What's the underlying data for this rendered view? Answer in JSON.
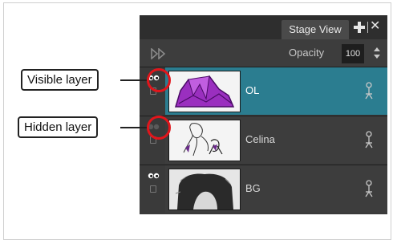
{
  "panel": {
    "tab_label": "Stage View",
    "opacity_label": "Opacity",
    "opacity_value": "100"
  },
  "layers": [
    {
      "name": "OL",
      "visible": true,
      "selected": true
    },
    {
      "name": "Celina",
      "visible": false,
      "selected": false
    },
    {
      "name": "BG",
      "visible": true,
      "selected": false
    }
  ],
  "callouts": {
    "visible": "Visible layer",
    "hidden": "Hidden layer"
  },
  "colors": {
    "selected_row": "#2b7d90",
    "highlight_ring": "#e2151b",
    "panel_bg": "#3a3a3a"
  }
}
